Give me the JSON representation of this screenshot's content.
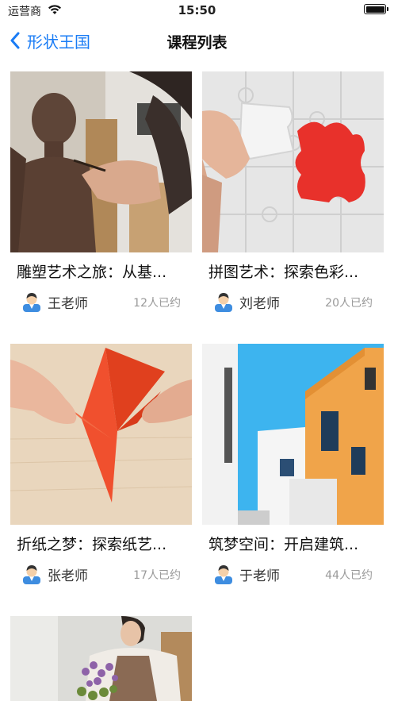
{
  "status": {
    "carrier": "运营商",
    "time": "15:50"
  },
  "nav": {
    "back_label": "形状王国",
    "title": "课程列表"
  },
  "courses": [
    {
      "title": "雕塑艺术之旅：从基...",
      "teacher": "王老师",
      "count": "12人已约"
    },
    {
      "title": "拼图艺术：探索色彩...",
      "teacher": "刘老师",
      "count": "20人已约"
    },
    {
      "title": "折纸之梦：探索纸艺...",
      "teacher": "张老师",
      "count": "17人已约"
    },
    {
      "title": "筑梦空间：开启建筑...",
      "teacher": "于老师",
      "count": "44人已约"
    },
    {
      "title": "",
      "teacher": "",
      "count": ""
    }
  ],
  "colors": {
    "accent": "#1a7cf5",
    "puzzle_red": "#e8312b",
    "origami_orange": "#f0502e",
    "sky": "#3db4ef",
    "building_yellow": "#f0a44a"
  },
  "icons": {
    "back": "chevron-left-icon",
    "wifi": "wifi-icon",
    "battery": "battery-icon",
    "avatar": "teacher-avatar-icon"
  }
}
